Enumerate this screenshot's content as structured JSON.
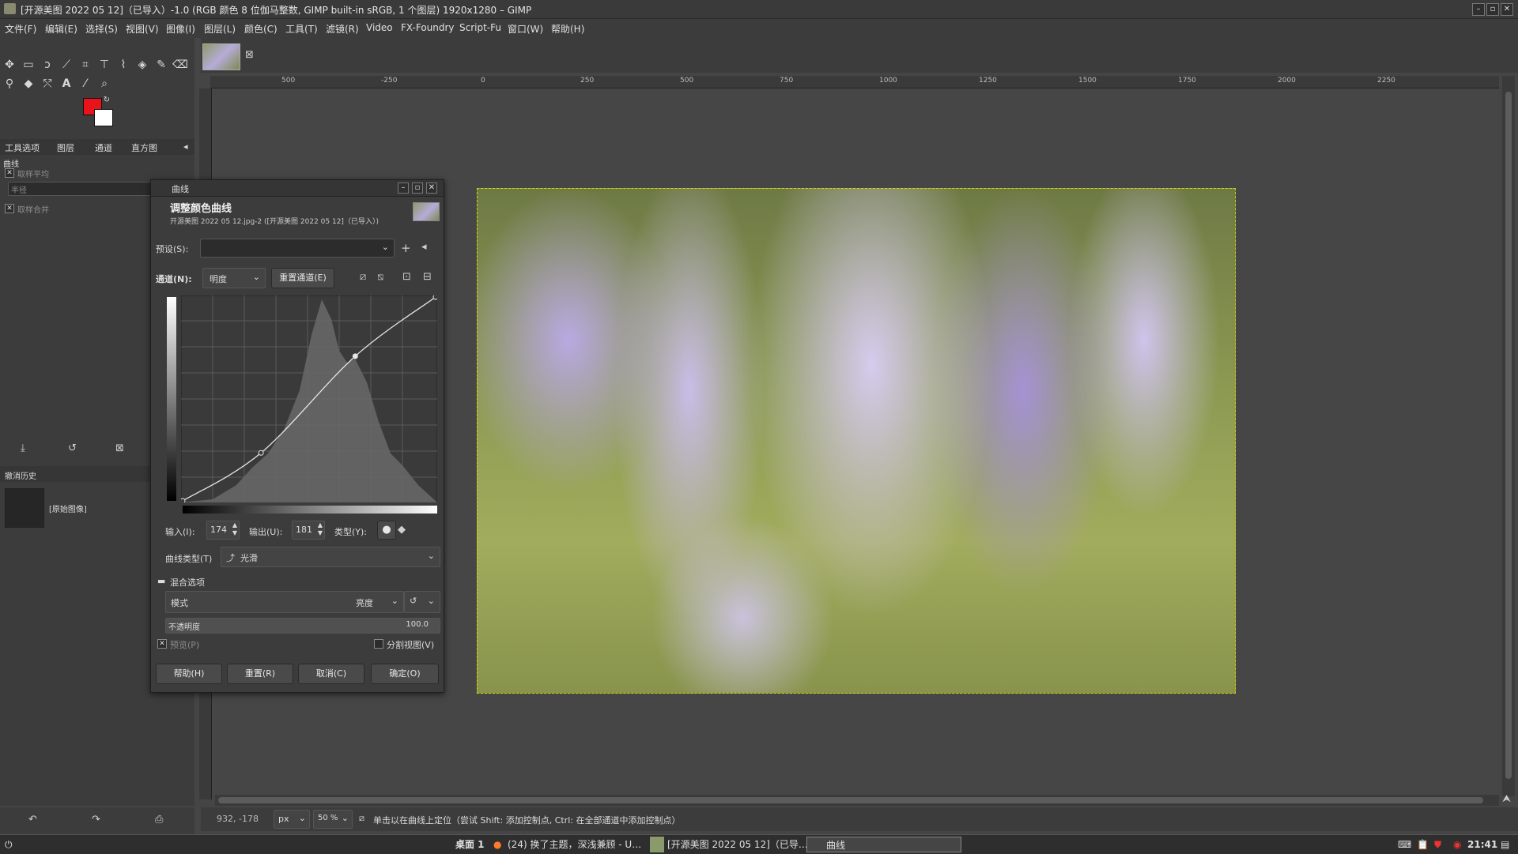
{
  "window": {
    "title": "[开源美图 2022 05 12]（已导入）-1.0 (RGB 颜色 8 位伽马整数, GIMP built-in sRGB, 1 个图层) 1920x1280 – GIMP"
  },
  "menubar": [
    "文件(F)",
    "编辑(E)",
    "选择(S)",
    "视图(V)",
    "图像(I)",
    "图层(L)",
    "颜色(C)",
    "工具(T)",
    "滤镜(R)",
    "Video",
    "FX-Foundry",
    "Script-Fu",
    "窗口(W)",
    "帮助(H)"
  ],
  "colors": {
    "foreground": "#e8141a",
    "background": "#ffffff",
    "selection_outline": "#ddd400"
  },
  "dock_tabs": [
    "工具选项",
    "图层",
    "通道",
    "直方图"
  ],
  "tool_options": {
    "title": "曲线",
    "sample_average": "取样平均",
    "radius": "半径",
    "sample_merged": "取样合并"
  },
  "undo_history": {
    "tab": "撤消历史",
    "item": "[原始图像]"
  },
  "ruler_h_labels": [
    "500",
    "-250",
    "0",
    "250",
    "500",
    "750",
    "1000",
    "1250",
    "1500",
    "1750",
    "2000",
    "2250"
  ],
  "curves_dialog": {
    "title": "曲线",
    "heading": "调整颜色曲线",
    "subtitle": "开源美图 2022 05 12.jpg-2 ([开源美图 2022 05 12]（已导入）)",
    "presets_label": "预设(S):",
    "channel_label": "通道(N):",
    "channel_value": "明度",
    "reset_channel": "重置通道(E)",
    "input_label": "输入(I):",
    "input_value": "174",
    "output_label": "输出(U):",
    "output_value": "181",
    "type_label": "类型(Y):",
    "curve_type_label": "曲线类型(T)",
    "curve_type_value": "光滑",
    "blend_options": "混合选项",
    "mode_label": "模式",
    "mode_value": "亮度",
    "opacity_label": "不透明度",
    "opacity_value": "100.0",
    "preview_label": "预览(P)",
    "split_view_label": "分割视图(V)",
    "buttons": {
      "help": "帮助(H)",
      "reset": "重置(R)",
      "cancel": "取消(C)",
      "ok": "确定(O)"
    },
    "curve_points": [
      [
        0,
        0
      ],
      [
        79,
        60
      ],
      [
        174,
        181
      ],
      [
        255,
        255
      ]
    ]
  },
  "statusbar": {
    "coords": "932, -178",
    "unit": "px",
    "zoom": "50 %",
    "message": "单击以在曲线上定位（尝试 Shift: 添加控制点, Ctrl: 在全部通道中添加控制点）"
  },
  "taskbar": {
    "desktop": "桌面 1",
    "items": [
      "(24) 换了主题，深浅兼顾 - U…",
      "[开源美图 2022 05 12]（已导…",
      "曲线"
    ],
    "time": "21:41"
  }
}
